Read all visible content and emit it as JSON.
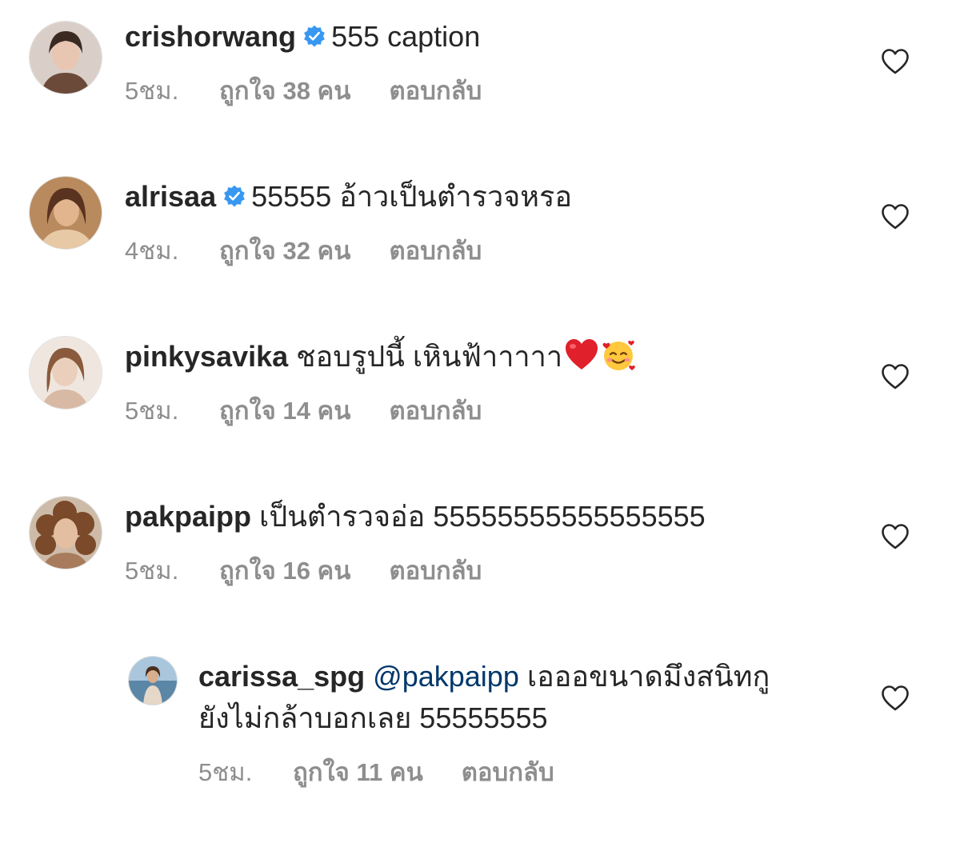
{
  "comments": [
    {
      "username": "crishorwang",
      "verified": true,
      "text": "555 caption",
      "time": "5ชม.",
      "likes": "ถูกใจ 38 คน",
      "reply": "ตอบกลับ"
    },
    {
      "username": "alrisaa",
      "verified": true,
      "text": "55555 อ้าวเป็นตำรวจหรอ",
      "time": "4ชม.",
      "likes": "ถูกใจ 32 คน",
      "reply": "ตอบกลับ"
    },
    {
      "username": "pinkysavika",
      "verified": false,
      "text": "ชอบรูปนี้ เหินฟ้าาาาา",
      "emojis": [
        "red-heart-emoji",
        "smiling-face-with-hearts-emoji"
      ],
      "time": "5ชม.",
      "likes": "ถูกใจ 14 คน",
      "reply": "ตอบกลับ"
    },
    {
      "username": "pakpaipp",
      "verified": false,
      "text": "เป็นตำรวจอ่อ 55555555555555555",
      "time": "5ชม.",
      "likes": "ถูกใจ 16 คน",
      "reply": "ตอบกลับ"
    }
  ],
  "reply_comment": {
    "username": "carissa_spg",
    "mention": "@pakpaipp",
    "text_line1": "เอออขนาดมึงสนิทกู",
    "text_line2": "ยังไม่กล้าบอกเลย 55555555",
    "time": "5ชม.",
    "likes": "ถูกใจ 11 คน",
    "reply": "ตอบกลับ"
  },
  "colors": {
    "text": "#262626",
    "meta": "#8e8e8e",
    "mention": "#00376b",
    "verified_badge": "#3897f0",
    "heart_outline": "#262626"
  },
  "icons": {
    "verified": "verified-badge-icon",
    "like": "heart-outline-icon"
  }
}
